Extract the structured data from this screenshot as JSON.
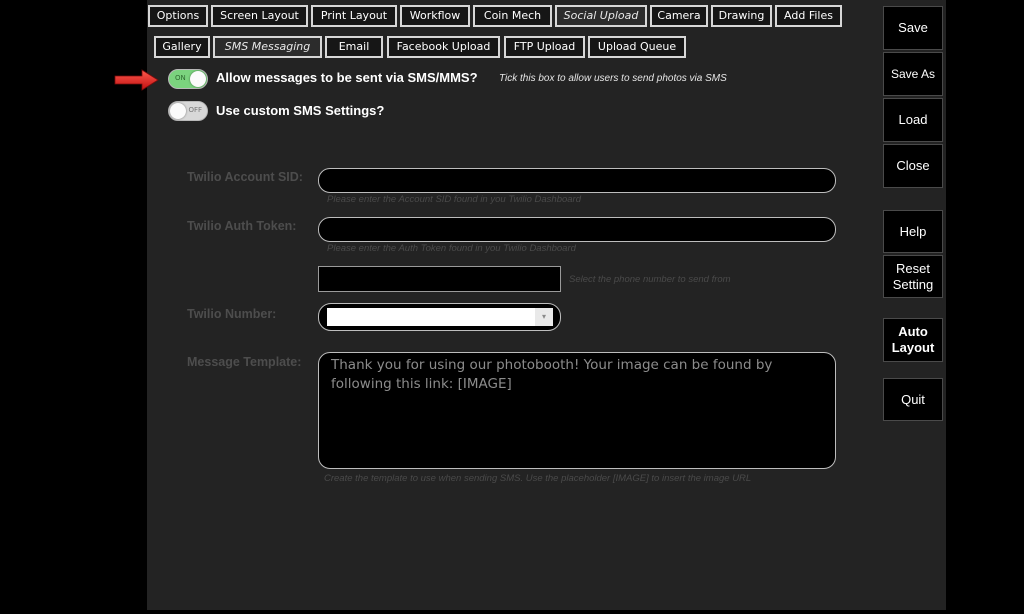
{
  "top_tabs": [
    "Options",
    "Screen Layout",
    "Print Layout",
    "Workflow",
    "Coin Mech",
    "Social Upload",
    "Camera",
    "Drawing",
    "Add Files"
  ],
  "active_top_tab": "Social Upload",
  "sub_tabs": [
    "Gallery",
    "SMS Messaging",
    "Email",
    "Facebook Upload",
    "FTP Upload",
    "Upload Queue"
  ],
  "active_sub_tab": "SMS Messaging",
  "options": {
    "allow_sms": {
      "label": "Allow messages to be sent via SMS/MMS?",
      "hint": "Tick this box to allow users to send photos via SMS",
      "state": "ON"
    },
    "custom_sms": {
      "label": "Use custom SMS Settings?",
      "state": "OFF"
    }
  },
  "fields": {
    "account_sid": {
      "label": "Twilio Account SID:",
      "hint": "Please enter the Account SID found in you Twilio Dashboard",
      "value": ""
    },
    "auth_token": {
      "label": "Twilio Auth Token:",
      "hint": "Please enter the Auth Token found in you Twilio Dashboard",
      "value": ""
    },
    "phone_select": {
      "hint": "Select the phone number to send from",
      "value": ""
    },
    "twilio_number": {
      "label": "Twilio Number:",
      "value": ""
    },
    "message_template": {
      "label": "Message Template:",
      "value": "Thank you for using our photobooth! Your image can be found by following this link: [IMAGE]",
      "hint": "Create the template to use when sending SMS. Use the placeholder [IMAGE] to insert the image URL"
    }
  },
  "side_buttons": {
    "save": "Save",
    "save_as": "Save As",
    "load": "Load",
    "close": "Close",
    "help": "Help",
    "reset_setting": "Reset Setting",
    "auto_layout": "Auto Layout",
    "quit": "Quit"
  },
  "colors": {
    "toggle_on": "#7bd37e",
    "pointer_arrow": "#e02020",
    "panel_bg": "#232323"
  }
}
